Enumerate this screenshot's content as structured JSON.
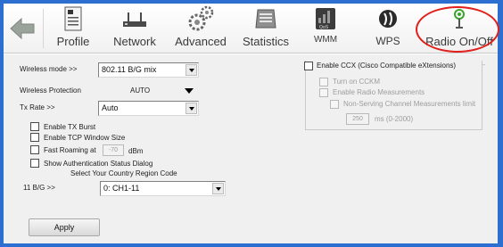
{
  "toolbar": {
    "items": [
      {
        "label": "Profile",
        "icon": "profile-icon"
      },
      {
        "label": "Network",
        "icon": "network-icon"
      },
      {
        "label": "Advanced",
        "icon": "gears-icon"
      },
      {
        "label": "Statistics",
        "icon": "statistics-icon"
      },
      {
        "label": "WMM",
        "icon": "wmm-icon"
      },
      {
        "label": "WPS",
        "icon": "wps-icon"
      },
      {
        "label": "Radio On/Off",
        "icon": "radio-icon"
      }
    ],
    "highlight_color": "#e0201c"
  },
  "advanced": {
    "wireless_mode": {
      "label": "Wireless mode >>",
      "value": "802.11 B/G mix"
    },
    "wireless_protection": {
      "label": "Wireless Protection",
      "value": "AUTO"
    },
    "tx_rate": {
      "label": "Tx Rate >>",
      "value": "Auto"
    },
    "enable_tx_burst": {
      "label": "Enable TX Burst",
      "checked": false
    },
    "enable_tcp_window": {
      "label": "Enable TCP Window Size",
      "checked": false
    },
    "fast_roaming": {
      "label": "Fast Roaming at",
      "value": "-70",
      "unit": "dBm",
      "checked": false
    },
    "show_auth": {
      "label": "Show Authentication Status Dialog",
      "checked": false
    },
    "region_title": "Select Your Country Region Code",
    "region": {
      "label": "11 B/G >>",
      "value": "0: CH1-11"
    },
    "apply_label": "Apply"
  },
  "ccx": {
    "enable_label": "Enable CCX (Cisco Compatible eXtensions)",
    "turn_on_ccmk": "Turn on CCKM",
    "enable_radio_measurements": "Enable Radio Measurements",
    "non_serving_limit": "Non-Serving Channel Measurements limit",
    "ms_value": "250",
    "ms_unit": "ms (0-2000)"
  }
}
